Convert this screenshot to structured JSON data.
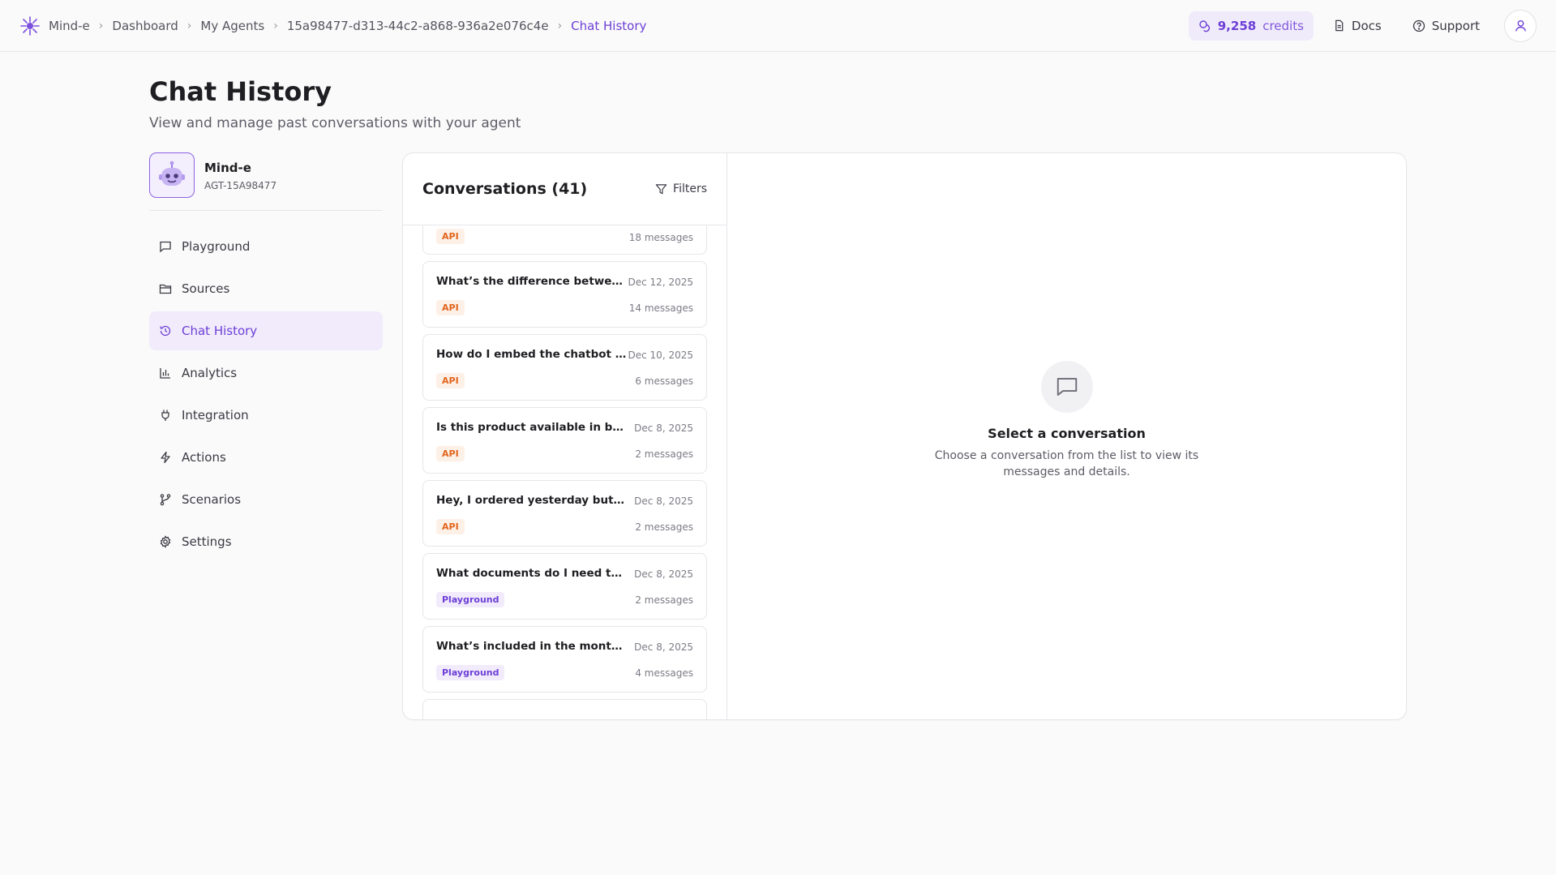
{
  "breadcrumb": {
    "items": [
      "Mind-e",
      "Dashboard",
      "My Agents",
      "15a98477-d313-44c2-a868-936a2e076c4e"
    ],
    "current": "Chat History"
  },
  "topbar": {
    "credits_value": "9,258",
    "credits_label": "credits",
    "docs": "Docs",
    "support": "Support"
  },
  "header": {
    "title": "Chat History",
    "subtitle": "View and manage past conversations with your agent"
  },
  "agent": {
    "name": "Mind-e",
    "id": "AGT-15A98477"
  },
  "nav": {
    "items": [
      {
        "label": "Playground",
        "icon": "message-square-icon"
      },
      {
        "label": "Sources",
        "icon": "folder-icon"
      },
      {
        "label": "Chat History",
        "icon": "history-icon",
        "active": true
      },
      {
        "label": "Analytics",
        "icon": "bar-chart-icon"
      },
      {
        "label": "Integration",
        "icon": "plug-icon"
      },
      {
        "label": "Actions",
        "icon": "lightning-icon"
      },
      {
        "label": "Scenarios",
        "icon": "git-branch-icon"
      },
      {
        "label": "Settings",
        "icon": "gear-icon"
      }
    ]
  },
  "conversations": {
    "title": "Conversations (41)",
    "filters_label": "Filters",
    "items": [
      {
        "question": "",
        "date": "",
        "source": "API",
        "messages": "18 messages"
      },
      {
        "question": "What’s the difference between the plans?",
        "date": "Dec 12, 2025",
        "source": "API",
        "messages": "14 messages"
      },
      {
        "question": "How do I embed the chatbot on my site?",
        "date": "Dec 10, 2025",
        "source": "API",
        "messages": "6 messages"
      },
      {
        "question": "Is this product available in black?",
        "date": "Dec 8, 2025",
        "source": "API",
        "messages": "2 messages"
      },
      {
        "question": "Hey, I ordered yesterday but didn't get a confirmation",
        "date": "Dec 8, 2025",
        "source": "API",
        "messages": "2 messages"
      },
      {
        "question": "What documents do I need to get started?",
        "date": "Dec 8, 2025",
        "source": "Playground",
        "messages": "2 messages"
      },
      {
        "question": "What’s included in the monthly plan?",
        "date": "Dec 8, 2025",
        "source": "Playground",
        "messages": "4 messages"
      }
    ]
  },
  "empty_state": {
    "title": "Select a conversation",
    "description": "Choose a conversation from the list to view its messages and details."
  },
  "colors": {
    "accent": "#6d3fd6",
    "api_tag": "#e2651c",
    "background": "#fafafa"
  }
}
